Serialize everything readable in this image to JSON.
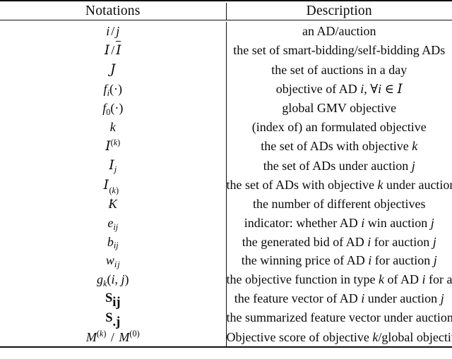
{
  "table": {
    "headers": {
      "notation": "Notations",
      "description": "Description"
    },
    "rows": [
      {
        "notation_text": "i / j",
        "description": "an AD/auction"
      },
      {
        "notation_text": "I / Ī",
        "description": "the set of smart-bidding/self-bidding ADs"
      },
      {
        "notation_text": "J",
        "description": "the set of auctions in a day"
      },
      {
        "notation_text": "f_i(·)",
        "description": "objective of AD i, ∀i ∈ I"
      },
      {
        "notation_text": "f_0(·)",
        "description": "global GMV objective"
      },
      {
        "notation_text": "k",
        "description": "(index of) an formulated objective"
      },
      {
        "notation_text": "I^(k)",
        "description": "the set of ADs with objective k"
      },
      {
        "notation_text": "I_j",
        "description": "the set of ADs under auction j"
      },
      {
        "notation_text": "I_j^(k)",
        "description": "the set of ADs with objective k under auction j"
      },
      {
        "notation_text": "K",
        "description": "the number of different objectives"
      },
      {
        "notation_text": "e_ij",
        "description": "indicator: whether AD i win auction j"
      },
      {
        "notation_text": "b_ij",
        "description": "the generated bid of AD i for auction j"
      },
      {
        "notation_text": "w_ij",
        "description": "the winning price of AD i for auction j"
      },
      {
        "notation_text": "g_k(i, j)",
        "description": "the objective function in type k of AD i for auction j"
      },
      {
        "notation_text": "S_ij",
        "description": "the feature vector of AD i under auction j"
      },
      {
        "notation_text": "S_.j",
        "description": "the summarized feature vector under auction j"
      },
      {
        "notation_text": "M^(k) / M^(0)",
        "description": "Objective score of objective k/global objective"
      }
    ]
  },
  "style": {
    "rule_color": "#101010",
    "text_color": "#0a0a0a",
    "background": "#ffffff"
  }
}
